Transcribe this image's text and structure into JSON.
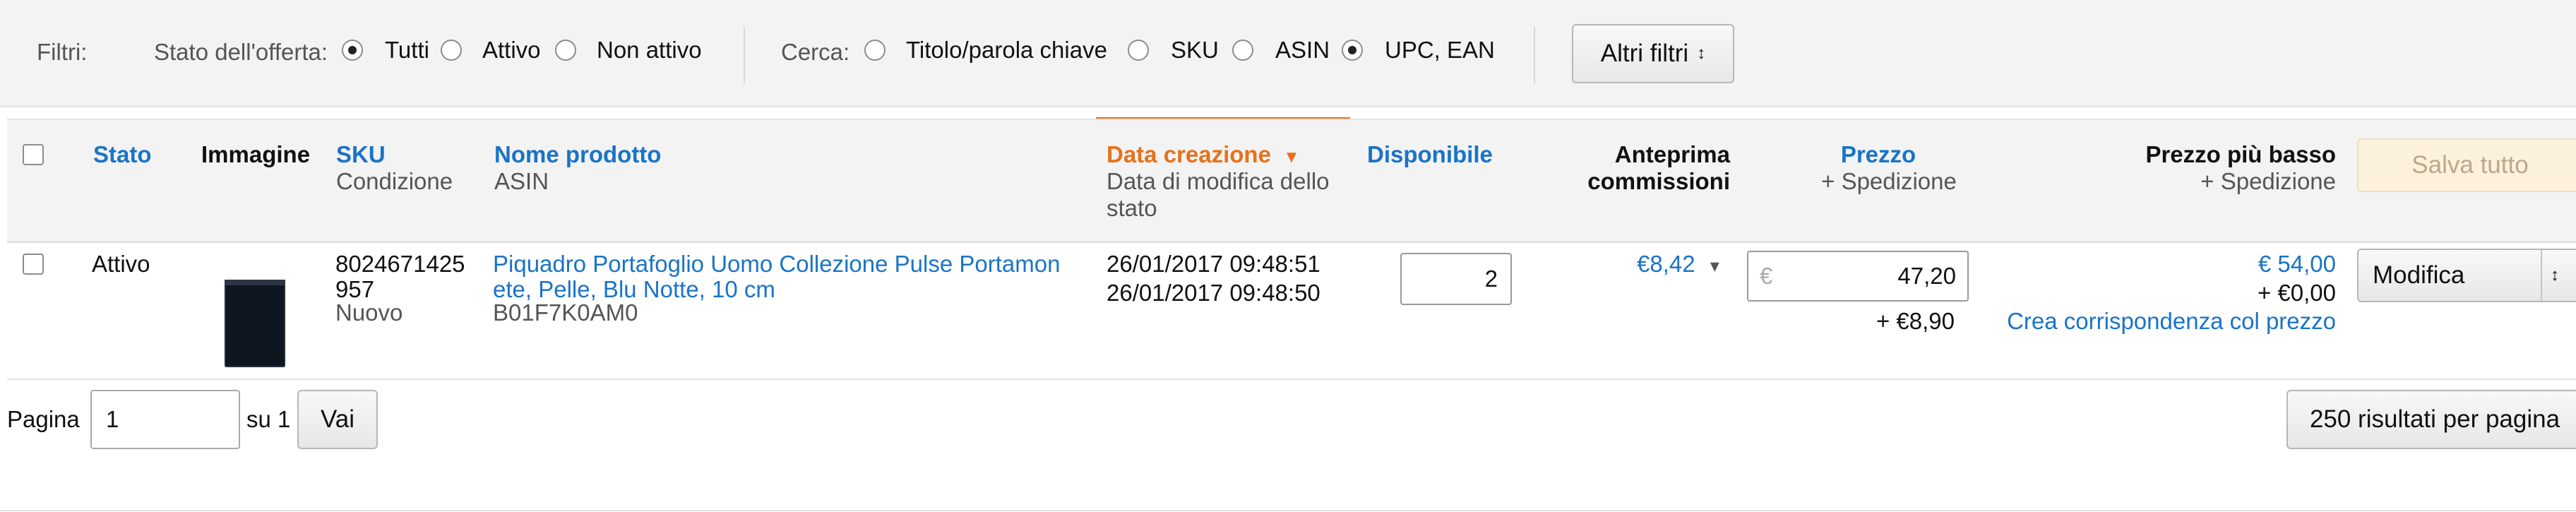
{
  "filters": {
    "label": "Filtri:",
    "status_label": "Stato dell'offerta:",
    "status_options": [
      {
        "label": "Tutti",
        "checked": true
      },
      {
        "label": "Attivo",
        "checked": false
      },
      {
        "label": "Non attivo",
        "checked": false
      }
    ],
    "search_label": "Cerca:",
    "search_options": [
      {
        "label": "Titolo/parola chiave",
        "checked": false
      },
      {
        "label": "SKU",
        "checked": false
      },
      {
        "label": "ASIN",
        "checked": false
      },
      {
        "label": "UPC, EAN",
        "checked": true
      }
    ],
    "more_filters": "Altri filtri",
    "more_filters_arrow": "↕"
  },
  "columns": {
    "status": "Stato",
    "image": "Immagine",
    "sku": "SKU",
    "condition": "Condizione",
    "product_name": "Nome prodotto",
    "asin": "ASIN",
    "created": "Data creazione",
    "created_sort_arrow": "▼",
    "modified_line1": "Data di modifica dello",
    "modified_line2": "stato",
    "available": "Disponibile",
    "fees_line1": "Anteprima",
    "fees_line2": "commissioni",
    "price": "Prezzo",
    "price_shipping": "+ Spedizione",
    "lowest_price": "Prezzo più basso",
    "lowest_shipping": "+ Spedizione",
    "save_all": "Salva tutto"
  },
  "rows": [
    {
      "status": "Attivo",
      "sku_line1": "8024671425",
      "sku_line2": "957",
      "condition": "Nuovo",
      "name_line1": "Piquadro Portafoglio Uomo Collezione Pulse Portamon",
      "name_line2": "ete, Pelle, Blu Notte, 10 cm",
      "asin": "B01F7K0AM0",
      "created": "26/01/2017 09:48:51",
      "modified": "26/01/2017 09:48:50",
      "available": "2",
      "fee": "€8,42",
      "fee_arrow": "▾",
      "currency": "€",
      "price": "47,20",
      "shipping": "+ €8,90",
      "lowest_price": "€ 54,00",
      "lowest_shipping": "+ €0,00",
      "match_price": "Crea corrispondenza col prezzo",
      "edit": "Modifica",
      "edit_arrow": "↕"
    }
  ],
  "pagination": {
    "label": "Pagina",
    "page": "1",
    "of": "su 1",
    "go": "Vai",
    "per_page": "250 risultati per pagina"
  }
}
